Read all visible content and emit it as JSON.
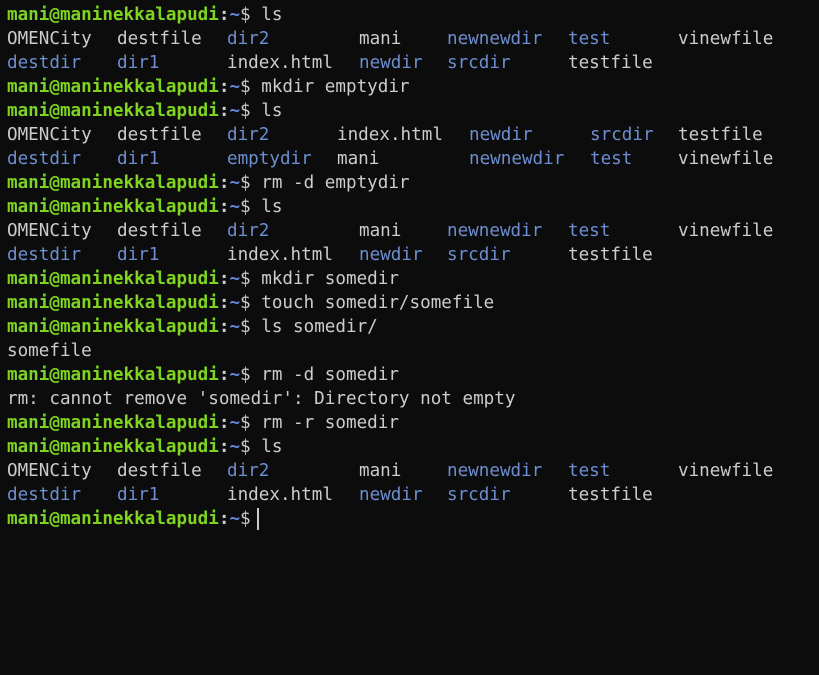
{
  "prompt": {
    "user": "mani@maninekkalapudi",
    "separator": ":",
    "path": "~",
    "symbol": "$"
  },
  "colors": {
    "background": "#0c0c0c",
    "foreground": "#cccccc",
    "prompt_user": "#7ed421",
    "prompt_path": "#5f87d7",
    "directory": "#6c8fd1"
  },
  "commands": {
    "c1": "ls",
    "c2": "mkdir emptydir",
    "c3": "ls",
    "c4": "rm -d emptydir",
    "c5": "ls",
    "c6": "mkdir somedir",
    "c7": "touch somedir/somefile",
    "c8": "ls somedir/",
    "c9": "rm -d somedir",
    "c10": "rm -r somedir",
    "c11": "ls"
  },
  "outputs": {
    "ls1": {
      "row1": [
        "OMENCity",
        "destfile",
        "dir2",
        "mani",
        "newnewdir",
        "test",
        "vinewfile"
      ],
      "row2": [
        "destdir",
        "dir1",
        "index.html",
        "newdir",
        "srcdir",
        "testfile"
      ]
    },
    "ls2": {
      "row1": [
        "OMENCity",
        "destfile",
        "dir2",
        "index.html",
        "newdir",
        "srcdir",
        "testfile"
      ],
      "row2": [
        "destdir",
        "dir1",
        "emptydir",
        "mani",
        "newnewdir",
        "test",
        "vinewfile"
      ]
    },
    "ls3": {
      "row1": [
        "OMENCity",
        "destfile",
        "dir2",
        "mani",
        "newnewdir",
        "test",
        "vinewfile"
      ],
      "row2": [
        "destdir",
        "dir1",
        "index.html",
        "newdir",
        "srcdir",
        "testfile"
      ]
    },
    "ls_somedir": "somefile",
    "rm_error": "rm: cannot remove 'somedir': Directory not empty",
    "ls4": {
      "row1": [
        "OMENCity",
        "destfile",
        "dir2",
        "mani",
        "newnewdir",
        "test",
        "vinewfile"
      ],
      "row2": [
        "destdir",
        "dir1",
        "index.html",
        "newdir",
        "srcdir",
        "testfile"
      ]
    }
  }
}
